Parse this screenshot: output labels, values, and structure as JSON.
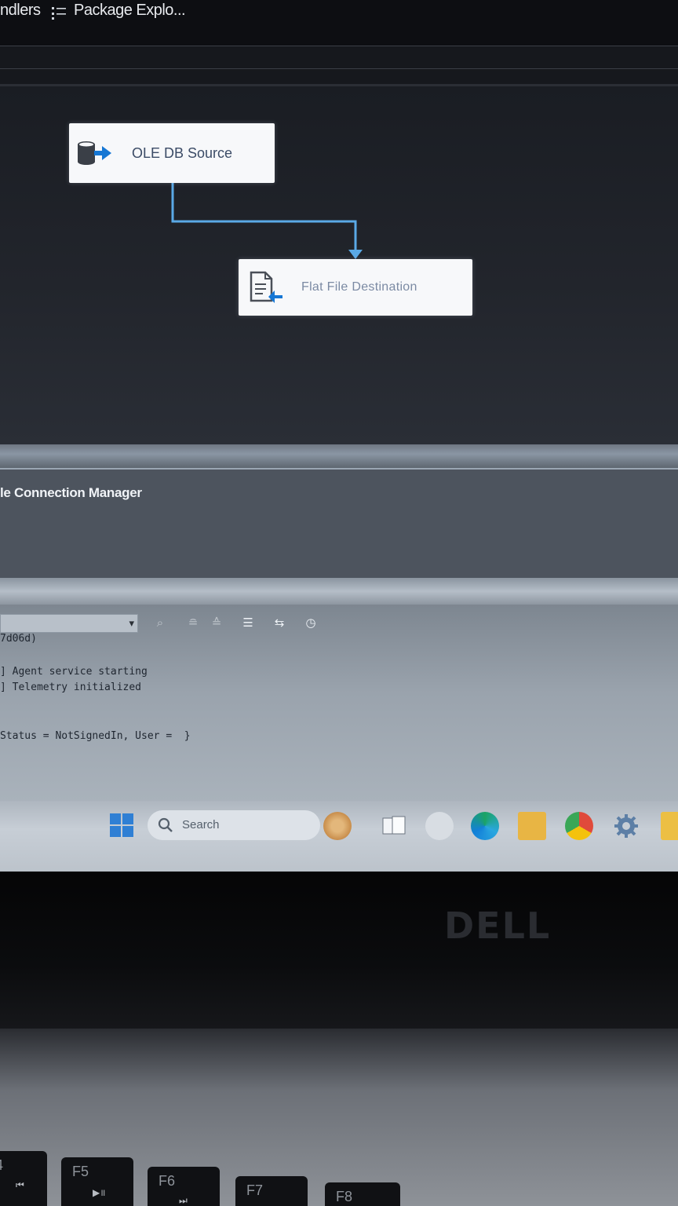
{
  "tabs": {
    "tab1_label": "ndlers",
    "tab2_label": "Package Explo..."
  },
  "designer": {
    "source_node_label": "OLE DB Source",
    "destination_node_label": "Flat File Destination"
  },
  "connection_pane": {
    "title": "le Connection Manager"
  },
  "output": {
    "lines": [
      "7d06d)",
      "] Agent service starting",
      "] Telemetry initialized",
      "Status = NotSignedIn, User =  }"
    ]
  },
  "taskbar": {
    "search_placeholder": "Search",
    "apps": [
      "widgets-icon",
      "task-view-icon",
      "chat-icon",
      "edge-icon",
      "file-explorer-icon",
      "chrome-icon",
      "settings-icon",
      "store-icon"
    ]
  },
  "laptop": {
    "brand": "DELL",
    "keys": [
      "4",
      "F5",
      "F6",
      "F7",
      "F8"
    ]
  },
  "colors": {
    "connector": "#5aa9e6",
    "node_bg": "#f7f8fa",
    "accent_blue": "#1677d4"
  }
}
